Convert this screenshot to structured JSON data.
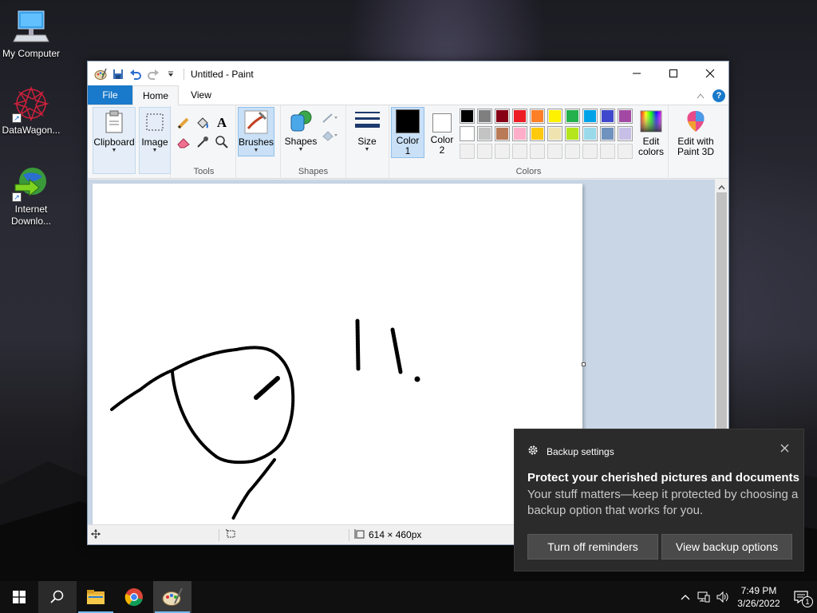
{
  "desktop": {
    "icons": [
      {
        "label": "My Computer"
      },
      {
        "label": "DataWagon..."
      },
      {
        "label": "Internet Downlo..."
      }
    ]
  },
  "window": {
    "title": "Untitled - Paint",
    "tabs": {
      "file": "File",
      "home": "Home",
      "view": "View"
    },
    "ribbon": {
      "clipboard": "Clipboard",
      "image": "Image",
      "tools_group": "Tools",
      "brushes": "Brushes",
      "shapes": "Shapes",
      "shapes_group": "Shapes",
      "size": "Size",
      "color1_a": "Color",
      "color1_b": "1",
      "color2_a": "Color",
      "color2_b": "2",
      "colors_group": "Colors",
      "edit_colors_a": "Edit",
      "edit_colors_b": "colors",
      "paint3d_a": "Edit with",
      "paint3d_b": "Paint 3D"
    },
    "palette_row1": [
      "#000000",
      "#7f7f7f",
      "#880015",
      "#ed1c24",
      "#ff7f27",
      "#fff200",
      "#22b14c",
      "#00a2e8",
      "#3f48cc",
      "#a349a4"
    ],
    "palette_row2": [
      "#ffffff",
      "#c3c3c3",
      "#b97a57",
      "#ffaec9",
      "#ffc90e",
      "#efe4b0",
      "#b5e61d",
      "#99d9ea",
      "#7092be",
      "#c8bfe7"
    ],
    "color1": "#000000",
    "color2": "#ffffff",
    "accent": "#1979ca",
    "status": {
      "dimensions": "614 × 460px"
    }
  },
  "toast": {
    "app": "Backup settings",
    "heading": "Protect your cherished pictures and documents",
    "body": "Your stuff matters—keep it protected by choosing a backup option that works for you.",
    "btn_off": "Turn off reminders",
    "btn_view": "View backup options"
  },
  "taskbar": {
    "time": "7:49 PM",
    "date": "3/26/2022",
    "notification_count": "1"
  }
}
